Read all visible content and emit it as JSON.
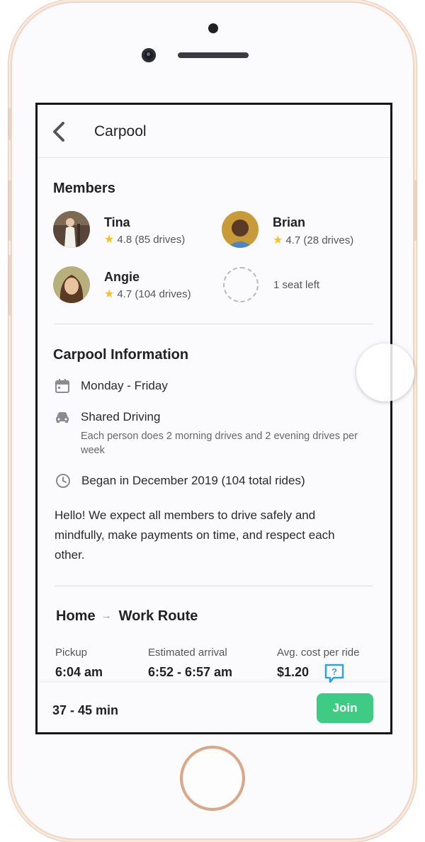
{
  "nav": {
    "title": "Carpool",
    "back_icon": "chevron-left-icon"
  },
  "members": {
    "title": "Members",
    "list": [
      {
        "name": "Tina",
        "rating": "4.8 (85 drives)"
      },
      {
        "name": "Brian",
        "rating": "4.7 (28 drives)"
      },
      {
        "name": "Angie",
        "rating": "4.7 (104 drives)"
      }
    ],
    "empty_seat_text": "1 seat left"
  },
  "info": {
    "title": "Carpool Information",
    "schedule": "Monday - Friday",
    "driving_mode": "Shared Driving",
    "driving_detail": "Each person does 2 morning drives and 2 evening drives per week",
    "began": "Began in December 2019 (104 total rides)",
    "description": "Hello! We expect all members to drive safely and mindfully, make payments on time, and respect each other."
  },
  "route": {
    "from": "Home",
    "to": "Work Route",
    "pickup_label": "Pickup",
    "pickup_value": "6:04 am",
    "arrival_label": "Estimated arrival",
    "arrival_value": "6:52 - 6:57 am",
    "cost_label": "Avg. cost per ride",
    "cost_value": "$1.20"
  },
  "footer": {
    "duration": "37 - 45 min",
    "join_label": "Join"
  },
  "colors": {
    "accent": "#3ecb83",
    "star": "#f5c123",
    "help_icon": "#2aa3e0"
  }
}
